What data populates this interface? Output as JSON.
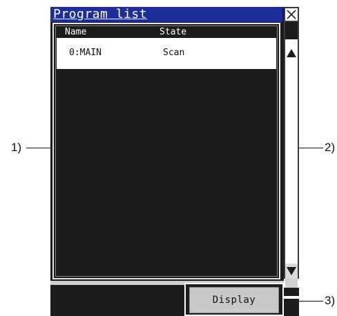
{
  "window": {
    "title": "Program list"
  },
  "table": {
    "columns": [
      "Name",
      "State"
    ],
    "rows": [
      {
        "name": "0:MAIN",
        "state": "Scan"
      }
    ]
  },
  "buttons": {
    "display_label": "Display"
  },
  "callouts": {
    "left": "1)",
    "right": "2)",
    "bottom_right": "3)"
  },
  "icons": {
    "close": "close-icon",
    "scroll_up": "triangle-up-icon",
    "scroll_down": "triangle-down-icon"
  },
  "colors": {
    "title_bar": "#1d2e9b",
    "background_dark": "#1c1c1c",
    "row_selected": "#ffffff",
    "button_face": "#c8c8c8"
  }
}
